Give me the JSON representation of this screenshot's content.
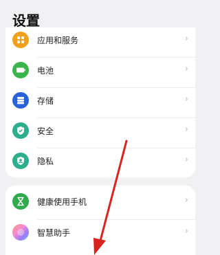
{
  "status_bar": {
    "left": "",
    "right": ""
  },
  "page": {
    "title": "设置"
  },
  "groups": [
    {
      "items": [
        {
          "label": "应用和服务",
          "icon": "apps-icon",
          "color": "#f0a11c"
        },
        {
          "label": "电池",
          "icon": "battery-icon",
          "color": "#3bb54a"
        },
        {
          "label": "存储",
          "icon": "storage-icon",
          "color": "#2a62d9"
        },
        {
          "label": "安全",
          "icon": "shield-icon",
          "color": "#2fae8e"
        },
        {
          "label": "隐私",
          "icon": "privacy-icon",
          "color": "#2fae8e"
        }
      ]
    },
    {
      "items": [
        {
          "label": "健康使用手机",
          "icon": "hourglass-icon",
          "color": "#2faa4c"
        },
        {
          "label": "智慧助手",
          "icon": "assistant-icon",
          "color": "#c774e8"
        }
      ]
    }
  ],
  "annotation": {
    "type": "arrow",
    "color": "#d9231f"
  },
  "chevron": "›"
}
